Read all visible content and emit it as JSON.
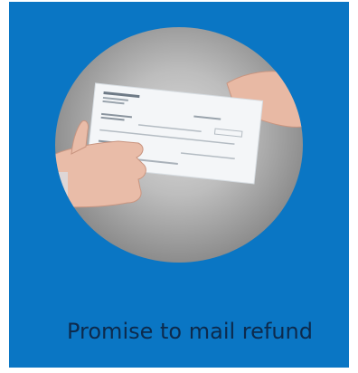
{
  "card": {
    "caption": "Promise to mail refund",
    "background_color": "#0a76c4",
    "caption_color": "#0d2a4c"
  },
  "photo": {
    "icon": "check-handover-photo"
  }
}
